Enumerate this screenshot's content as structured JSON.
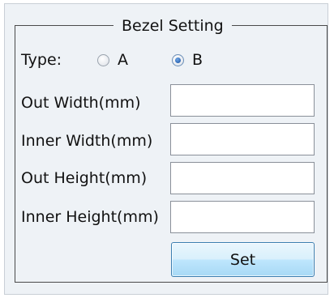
{
  "group": {
    "title": "Bezel Setting"
  },
  "type_row": {
    "label": "Type:",
    "options": [
      {
        "label": "A",
        "selected": false
      },
      {
        "label": "B",
        "selected": true
      }
    ]
  },
  "fields": [
    {
      "label": "Out Width(mm)",
      "value": ""
    },
    {
      "label": "Inner Width(mm)",
      "value": ""
    },
    {
      "label": "Out Height(mm)",
      "value": ""
    },
    {
      "label": "Inner Height(mm)",
      "value": ""
    }
  ],
  "set_button": {
    "label": "Set"
  }
}
